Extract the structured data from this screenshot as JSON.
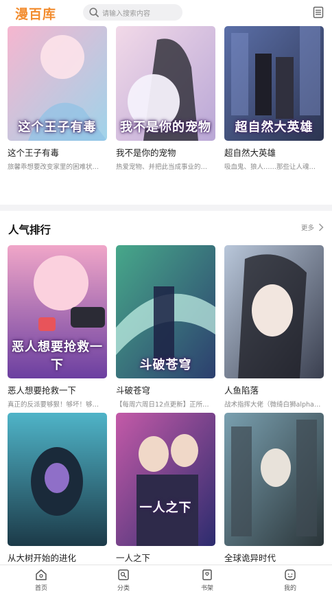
{
  "app": {
    "logo": "漫百库"
  },
  "search": {
    "placeholder": "请输入搜索内容"
  },
  "top_cards": [
    {
      "title": "这个王子有毒",
      "desc": "旅馨乖想要改变家里的困难状…",
      "cover_text": "这个王子有毒",
      "c1": "#f6b6cf",
      "c2": "#9fd3ea"
    },
    {
      "title": "我不是你的宠物",
      "desc": "热爱宠物、并把此当成事业的…",
      "cover_text": "我不是你的宠物",
      "c1": "#f2d9e8",
      "c2": "#b9a7d6"
    },
    {
      "title": "超自然大英雄",
      "desc": "吸血鬼、狼人……那些让人魂…",
      "cover_text": "超自然大英雄",
      "c1": "#5b6fa8",
      "c2": "#2c3450"
    }
  ],
  "popular": {
    "heading": "人气排行",
    "more": "更多",
    "cards": [
      {
        "title": "恶人想要抢救一下",
        "desc": "真正的反派要够狠！够坏！够…",
        "cover_text": "恶人想要抢救一下",
        "c1": "#f0a6c8",
        "c2": "#6b3fa0"
      },
      {
        "title": "斗破苍穹",
        "desc": "【每周六周日12点更新】正所…",
        "cover_text": "斗破苍穹",
        "c1": "#47a88a",
        "c2": "#2c3f6e"
      },
      {
        "title": "人鱼陷落",
        "desc": "战术指挥大佬（微绮白狮alpha…",
        "cover_text": "",
        "c1": "#b9c7da",
        "c2": "#3a3f4f"
      },
      {
        "title": "从大树开始的进化",
        "desc": "",
        "cover_text": "",
        "c1": "#4fb4c8",
        "c2": "#1c3a48"
      },
      {
        "title": "一人之下",
        "desc": "",
        "cover_text": "一人之下",
        "c1": "#c45aa8",
        "c2": "#2c2c6e"
      },
      {
        "title": "全球诡异时代",
        "desc": "",
        "cover_text": "",
        "c1": "#7aa0b0",
        "c2": "#2a3438"
      }
    ]
  },
  "tabs": [
    {
      "label": "首页"
    },
    {
      "label": "分类"
    },
    {
      "label": "书架"
    },
    {
      "label": "我的"
    }
  ]
}
